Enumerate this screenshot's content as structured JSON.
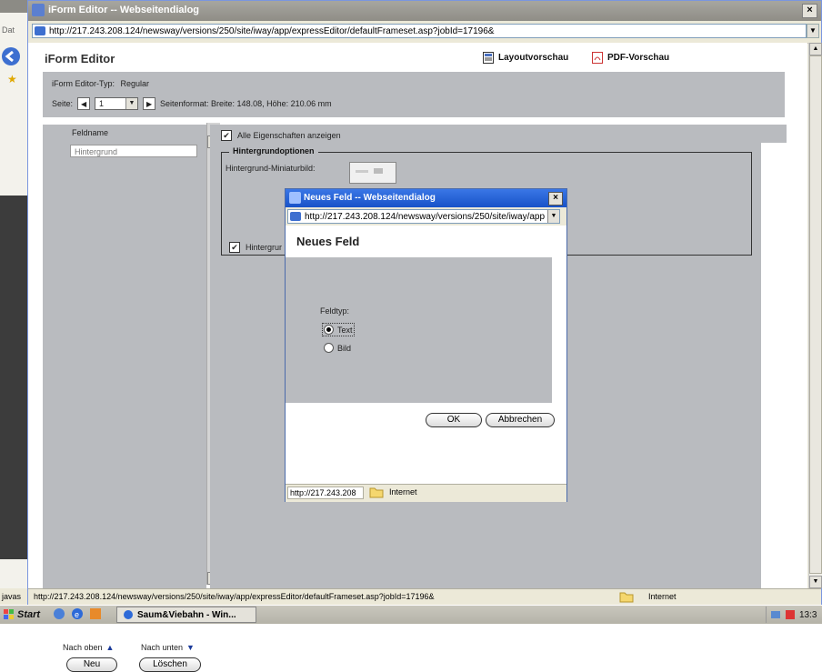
{
  "outer": {
    "status_prefix": "javas",
    "menu_text": "Dat"
  },
  "main_window": {
    "title": "iForm Editor -- Webseitendialog",
    "close": "×",
    "address": "http://217.243.208.124/newsway/versions/250/site/iway/app/expressEditor/defaultFrameset.asp?jobId=17196&",
    "status_url": "http://217.243.208.124/newsway/versions/250/site/iway/app/expressEditor/defaultFrameset.asp?jobId=17196&",
    "status_zone": "Internet"
  },
  "editor": {
    "title": "iForm Editor",
    "layout_preview": "Layoutvorschau",
    "pdf_preview": "PDF-Vorschau",
    "type_label": "iForm Editor-Typ:",
    "type_value": "Regular",
    "page_label": "Seite:",
    "page_value": "1",
    "page_format": "Seitenformat: Breite: 148.08, Höhe: 210.06 mm",
    "field_name_label": "Feldname",
    "field_name_placeholder": "Hintergrund",
    "move_up": "Nach oben",
    "move_down": "Nach unten",
    "new_button": "Neu",
    "delete_button": "Löschen",
    "show_all_props": "Alle Eigenschaften anzeigen",
    "bg_options_legend": "Hintergrundoptionen",
    "bg_thumb_label": "Hintergrund-Miniaturbild:",
    "bg_checkbox_label": "Hintergrur"
  },
  "dialog": {
    "title": "Neues Feld -- Webseitendialog",
    "close": "×",
    "address": "http://217.243.208.124/newsway/versions/250/site/iway/app",
    "heading": "Neues Feld",
    "field_type_label": "Feldtyp:",
    "options": [
      "Text",
      "Bild"
    ],
    "selected_option": "Text",
    "ok": "OK",
    "cancel": "Abbrechen",
    "status_url": "http://217.243.208",
    "status_zone": "Internet"
  },
  "taskbar": {
    "start": "Start",
    "task": "Saum&Viebahn - Win...",
    "clock": "13:3"
  },
  "colors": {
    "panel_gray": "#b9bbbf",
    "title_blue": "#1852c8",
    "inactive_title": "#8f8d86"
  }
}
